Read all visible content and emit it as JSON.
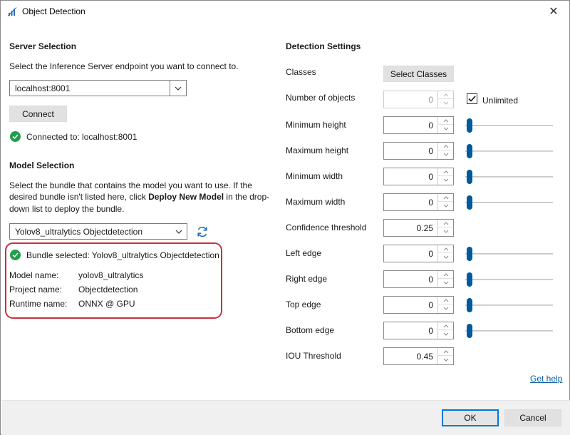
{
  "window": {
    "title": "Object Detection",
    "close_glyph": "✕"
  },
  "server": {
    "heading": "Server Selection",
    "description": "Select the Inference Server endpoint you want to connect to.",
    "endpoint_value": "localhost:8001",
    "connect_label": "Connect",
    "status_text": "Connected to: localhost:8001"
  },
  "model": {
    "heading": "Model Selection",
    "desc_line1": "Select the bundle that contains the model you want to use. If the",
    "desc_line2_a": "desired bundle isn't listed here, click ",
    "desc_line2_bold": "Deploy New Model",
    "desc_line2_b": " in the drop-",
    "desc_line3": "down list to deploy the bundle.",
    "bundle_value": "Yolov8_ultralytics Objectdetection",
    "bundle_status": "Bundle selected: Yolov8_ultralytics Objectdetection",
    "details": [
      {
        "label": "Model name:",
        "value": "yolov8_ultralytics"
      },
      {
        "label": "Project name:",
        "value": "Objectdetection"
      },
      {
        "label": "Runtime name:",
        "value": "ONNX @ GPU"
      }
    ]
  },
  "detection": {
    "heading": "Detection Settings",
    "classes_label": "Classes",
    "select_classes_label": "Select Classes",
    "unlimited_label": "Unlimited",
    "settings": [
      {
        "label": "Number of objects",
        "value": "0"
      },
      {
        "label": "Minimum height",
        "value": "0"
      },
      {
        "label": "Maximum height",
        "value": "0"
      },
      {
        "label": "Minimum width",
        "value": "0"
      },
      {
        "label": "Maximum width",
        "value": "0"
      },
      {
        "label": "Confidence threshold",
        "value": "0.25"
      },
      {
        "label": "Left edge",
        "value": "0"
      },
      {
        "label": "Right edge",
        "value": "0"
      },
      {
        "label": "Top edge",
        "value": "0"
      },
      {
        "label": "Bottom edge",
        "value": "0"
      },
      {
        "label": "IOU Threshold",
        "value": "0.45"
      }
    ],
    "help_label": "Get help"
  },
  "footer": {
    "ok_label": "OK",
    "cancel_label": "Cancel"
  },
  "colors": {
    "accent": "#0078d7",
    "success": "#1f9e4c",
    "highlight": "#c8323a",
    "slider": "#005a9e"
  }
}
